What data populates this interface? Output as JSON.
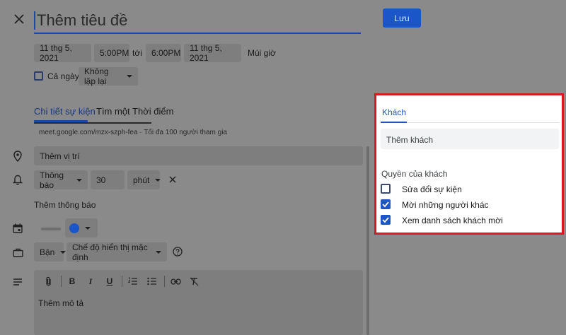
{
  "header": {
    "title_placeholder": "Thêm tiêu đề",
    "save_label": "Lưu"
  },
  "datetime": {
    "start_date": "11 thg 5, 2021",
    "start_time": "5:00PM",
    "to_label": "tới",
    "end_time": "6:00PM",
    "end_date": "11 thg 5, 2021",
    "timezone_label": "Múi giờ",
    "all_day_label": "Cả ngày",
    "repeat_value": "Không lặp lại"
  },
  "tabs": {
    "details": "Chi tiết sự kiện",
    "find_time": "Tìm một Thời điểm"
  },
  "meet_info": "meet.google.com/mzx-szph-fea · Tối đa 100 người tham gia",
  "location_placeholder": "Thêm vị trí",
  "notification": {
    "type": "Thông báo",
    "amount": "30",
    "unit": "phút",
    "add_label": "Thêm thông báo"
  },
  "availability": {
    "status": "Bận",
    "visibility": "Chế độ hiển thị mặc định"
  },
  "description_placeholder": "Thêm mô tả",
  "guests_panel": {
    "tab_label": "Khách",
    "add_placeholder": "Thêm khách",
    "permissions_title": "Quyền của khách",
    "permissions": [
      {
        "label": "Sửa đổi sự kiện",
        "checked": false
      },
      {
        "label": "Mời những người khác",
        "checked": true
      },
      {
        "label": "Xem danh sách khách mời",
        "checked": true
      }
    ]
  },
  "colors": {
    "accent": "#1a56c8",
    "highlight_border": "#d9191f",
    "event_color": "#1a56c8"
  }
}
